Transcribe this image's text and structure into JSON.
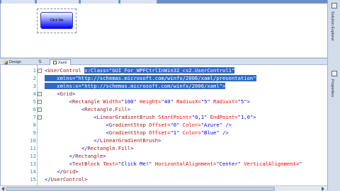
{
  "designer": {
    "button_text": "Click Me"
  },
  "split_bar": {
    "design_tab": "Design",
    "xaml_tab": "Xaml"
  },
  "right_dock": {
    "labels": [
      "Solution Explorer",
      "Properties"
    ]
  },
  "editor": {
    "lines": [
      {
        "n": "1",
        "outline": "-",
        "segments": [
          {
            "t": "<",
            "c": "br"
          },
          {
            "t": "UserControl",
            "c": "tag"
          },
          {
            "t": " ",
            "c": ""
          },
          {
            "t": "x:Class=\"GUI_For_WPFCtrlInWin32_cs2.UserControl1\"",
            "c": "attr",
            "sel": true
          }
        ]
      },
      {
        "n": "2",
        "outline": "",
        "segments": [
          {
            "t": "    xmlns=\"http://schemas.microsoft.com/winfx/2006/xaml/presentation\"",
            "c": "attr",
            "sel": true
          }
        ]
      },
      {
        "n": "3",
        "outline": "",
        "segments": [
          {
            "t": "    xmlns:x=\"http://schemas.microsoft.com/winfx/2006/xaml\">",
            "c": "attr",
            "sel": true
          }
        ]
      },
      {
        "n": "4",
        "outline": "-",
        "segments": [
          {
            "t": "    ",
            "c": ""
          },
          {
            "t": "<",
            "c": "br"
          },
          {
            "t": "Grid",
            "c": "tag"
          },
          {
            "t": ">",
            "c": "br"
          }
        ]
      },
      {
        "n": "5",
        "outline": "-",
        "segments": [
          {
            "t": "        ",
            "c": ""
          },
          {
            "t": "<",
            "c": "br"
          },
          {
            "t": "Rectangle",
            "c": "tag"
          },
          {
            "t": " Width=",
            "c": "attr"
          },
          {
            "t": "\"100\"",
            "c": "val"
          },
          {
            "t": " Height=",
            "c": "attr"
          },
          {
            "t": "\"40\"",
            "c": "val"
          },
          {
            "t": " RadiusX=",
            "c": "attr"
          },
          {
            "t": "\"5\"",
            "c": "val"
          },
          {
            "t": " RadiusY=",
            "c": "attr"
          },
          {
            "t": "\"5\"",
            "c": "val"
          },
          {
            "t": ">",
            "c": "br"
          }
        ]
      },
      {
        "n": "6",
        "outline": "-",
        "segments": [
          {
            "t": "            ",
            "c": ""
          },
          {
            "t": "<",
            "c": "br"
          },
          {
            "t": "Rectangle.Fill",
            "c": "tag"
          },
          {
            "t": ">",
            "c": "br"
          }
        ]
      },
      {
        "n": "7",
        "outline": "-",
        "segments": [
          {
            "t": "                ",
            "c": ""
          },
          {
            "t": "<",
            "c": "br"
          },
          {
            "t": "LinearGradientBrush",
            "c": "tag"
          },
          {
            "t": " StartPoint=",
            "c": "attr"
          },
          {
            "t": "\"0,1\"",
            "c": "val"
          },
          {
            "t": " EndPoint=",
            "c": "attr"
          },
          {
            "t": "\"1,0\"",
            "c": "val"
          },
          {
            "t": ">",
            "c": "br"
          }
        ]
      },
      {
        "n": "8",
        "outline": "",
        "segments": [
          {
            "t": "                    ",
            "c": ""
          },
          {
            "t": "<",
            "c": "br"
          },
          {
            "t": "GradientStop",
            "c": "tag"
          },
          {
            "t": " Offset=",
            "c": "attr"
          },
          {
            "t": "\"0\"",
            "c": "val"
          },
          {
            "t": " Color=",
            "c": "attr"
          },
          {
            "t": "\"Azure\"",
            "c": "val"
          },
          {
            "t": " />",
            "c": "br"
          }
        ]
      },
      {
        "n": "9",
        "outline": "",
        "segments": [
          {
            "t": "                    ",
            "c": ""
          },
          {
            "t": "<",
            "c": "br"
          },
          {
            "t": "GradientStop",
            "c": "tag"
          },
          {
            "t": " Offset=",
            "c": "attr"
          },
          {
            "t": "\"1\"",
            "c": "val"
          },
          {
            "t": " Color=",
            "c": "attr"
          },
          {
            "t": "\"Blue\"",
            "c": "val"
          },
          {
            "t": " />",
            "c": "br"
          }
        ]
      },
      {
        "n": "10",
        "outline": "",
        "segments": [
          {
            "t": "                ",
            "c": ""
          },
          {
            "t": "</",
            "c": "br"
          },
          {
            "t": "LinearGradientBrush",
            "c": "tag"
          },
          {
            "t": ">",
            "c": "br"
          }
        ]
      },
      {
        "n": "11",
        "outline": "",
        "segments": [
          {
            "t": "            ",
            "c": ""
          },
          {
            "t": "</",
            "c": "br"
          },
          {
            "t": "Rectangle.Fill",
            "c": "tag"
          },
          {
            "t": ">",
            "c": "br"
          }
        ]
      },
      {
        "n": "12",
        "outline": "",
        "segments": [
          {
            "t": "        ",
            "c": ""
          },
          {
            "t": "</",
            "c": "br"
          },
          {
            "t": "Rectangle",
            "c": "tag"
          },
          {
            "t": ">",
            "c": "br"
          }
        ]
      },
      {
        "n": "13",
        "outline": "",
        "segments": [
          {
            "t": "        ",
            "c": ""
          },
          {
            "t": "<",
            "c": "br"
          },
          {
            "t": "TextBlock",
            "c": "tag"
          },
          {
            "t": " Text=",
            "c": "attr"
          },
          {
            "t": "\"Click Me!\"",
            "c": "val"
          },
          {
            "t": " HorizontalAlignment=",
            "c": "attr"
          },
          {
            "t": "\"Center\"",
            "c": "val"
          },
          {
            "t": " VerticalAlignment=",
            "c": "attr"
          },
          {
            "t": "\"",
            "c": "val"
          }
        ]
      },
      {
        "n": "14",
        "outline": "",
        "segments": [
          {
            "t": "    ",
            "c": ""
          },
          {
            "t": "</",
            "c": "br"
          },
          {
            "t": "Grid",
            "c": "tag"
          },
          {
            "t": ">",
            "c": "br"
          }
        ]
      },
      {
        "n": "15",
        "outline": "",
        "segments": [
          {
            "t": "</",
            "c": "br"
          },
          {
            "t": "UserControl",
            "c": "tag"
          },
          {
            "t": ">",
            "c": "br"
          }
        ]
      }
    ]
  }
}
